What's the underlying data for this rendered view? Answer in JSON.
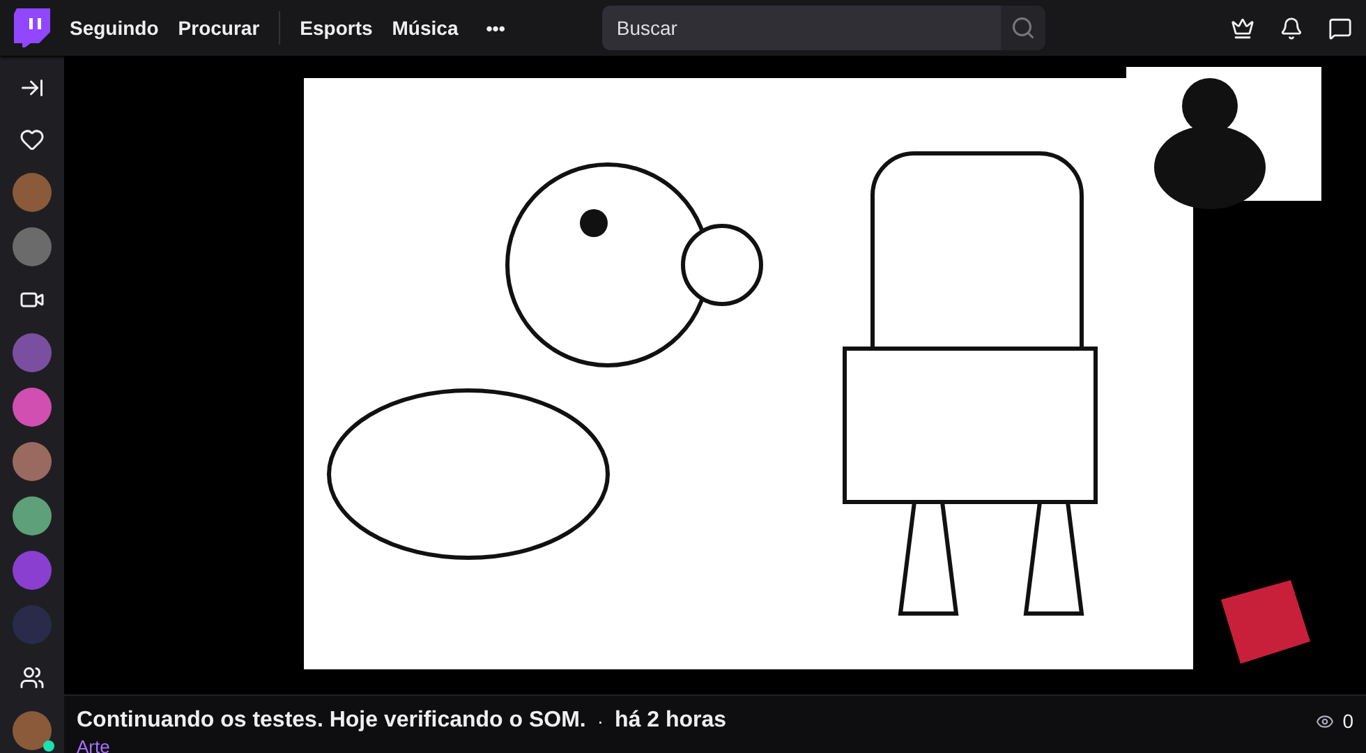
{
  "nav": {
    "links": [
      {
        "label": "Seguindo",
        "selected": false
      },
      {
        "label": "Procurar",
        "selected": false
      },
      {
        "label": "Esports",
        "selected": false
      },
      {
        "label": "Música",
        "selected": false
      }
    ],
    "more": "•••",
    "search": {
      "placeholder": "Buscar"
    }
  },
  "sidebar": {
    "items": [
      {
        "kind": "collapse"
      },
      {
        "kind": "heart"
      },
      {
        "kind": "avatar",
        "color": "#8a5a3a",
        "online": false
      },
      {
        "kind": "avatar",
        "color": "#6b6b6b",
        "online": false
      },
      {
        "kind": "camera"
      },
      {
        "kind": "avatar",
        "color": "#7b4fa0",
        "online": false
      },
      {
        "kind": "avatar",
        "color": "#d04fb0",
        "online": false
      },
      {
        "kind": "avatar",
        "color": "#9a6a60",
        "online": false
      },
      {
        "kind": "avatar",
        "color": "#5ea07a",
        "online": false
      },
      {
        "kind": "avatar",
        "color": "#8a3fd0",
        "online": false
      },
      {
        "kind": "avatar",
        "color": "#2a2a4a",
        "online": false
      },
      {
        "kind": "people"
      },
      {
        "kind": "avatar",
        "color": "#8a5a3a",
        "online": true
      }
    ]
  },
  "info": {
    "title": "Continuando os testes. Hoje verificando o SOM.",
    "separator": "·",
    "time": "há 2 horas",
    "viewers": "0",
    "category": "Arte"
  }
}
